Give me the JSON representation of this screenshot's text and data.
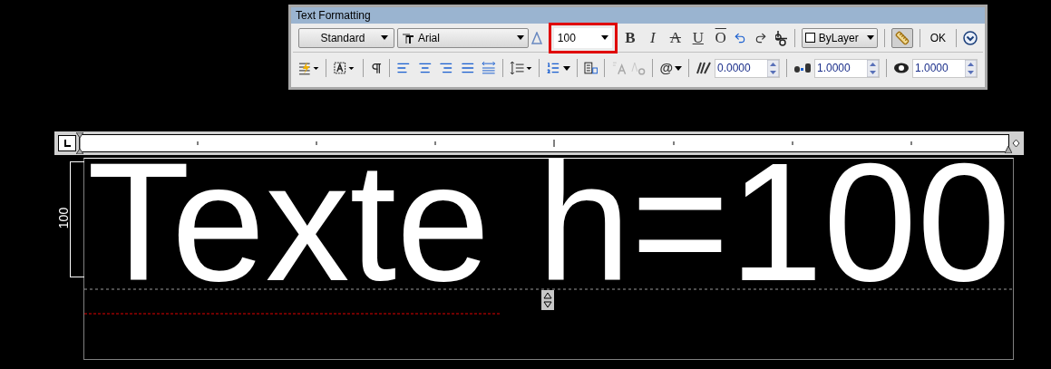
{
  "window": {
    "title": "Text Formatting"
  },
  "style_dropdown": {
    "value": "Standard"
  },
  "font_dropdown": {
    "value": "Arial"
  },
  "height_field": {
    "value": "100",
    "highlighted": true
  },
  "format_buttons": [
    {
      "kind": "bold",
      "label": "B"
    },
    {
      "kind": "italic",
      "label": "I"
    },
    {
      "kind": "strike",
      "label": "A"
    },
    {
      "kind": "underline",
      "label": "U"
    },
    {
      "kind": "overline",
      "label": "O"
    }
  ],
  "color_dropdown": {
    "value": "ByLayer",
    "checked": false
  },
  "ruler_button": {
    "on": true
  },
  "ok_button": {
    "label": "OK"
  },
  "symbol_button": {
    "label": "@"
  },
  "case_buttons": {
    "disabled": true
  },
  "spin_fields": [
    {
      "kind": "oblique",
      "value": "0.0000"
    },
    {
      "kind": "tracking",
      "value": "1.0000"
    },
    {
      "kind": "width",
      "value": "1.0000"
    }
  ],
  "dimension_label": "100",
  "editor_text": "Texte h=100"
}
